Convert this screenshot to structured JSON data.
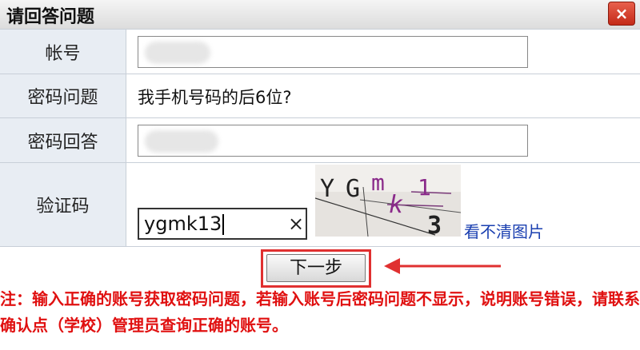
{
  "dialog": {
    "title": "请回答问题",
    "close_label": "×"
  },
  "form": {
    "account_label": "帐号",
    "account_value": "",
    "question_label": "密码问题",
    "question_text": "我手机号码的后6位?",
    "answer_label": "密码回答",
    "answer_value": "",
    "captcha_label": "验证码",
    "captcha_value": "ygmk13",
    "clear_label": "×",
    "captcha_chars": [
      "Y",
      "G",
      "m",
      "k",
      "1",
      "3"
    ],
    "refresh_link": "看不清图片"
  },
  "actions": {
    "next_label": "下一步"
  },
  "note": {
    "text": "注：输入正确的账号获取密码问题，若输入账号后密码问题不显示，说明账号错误，请联系确认点（学校）管理员查询正确的账号。"
  },
  "colors": {
    "annotation_red": "#e03030",
    "link_blue": "#1a3fb0",
    "label_bg": "#e8edf3"
  }
}
